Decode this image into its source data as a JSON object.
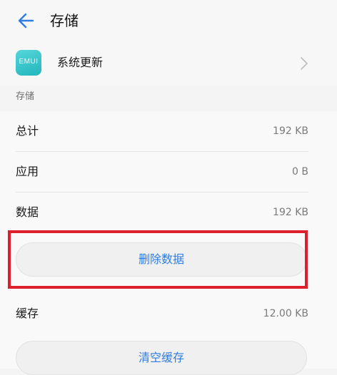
{
  "header": {
    "title": "存储",
    "back_icon": "arrow-left-icon",
    "accent": "#2f7de1"
  },
  "app": {
    "icon_name": "emui-app-icon",
    "icon_text": "EMUI",
    "name": "系统更新",
    "chevron_icon": "chevron-right-icon"
  },
  "storage": {
    "section_label": "存储",
    "rows": [
      {
        "label": "总计",
        "value": "192 KB"
      },
      {
        "label": "应用",
        "value": "0 B"
      },
      {
        "label": "数据",
        "value": "192 KB"
      }
    ],
    "delete_data_label": "删除数据",
    "cache_label": "缓存",
    "cache_value": "12.00 KB",
    "clear_cache_label": "清空缓存"
  },
  "highlight_color": "#dd1f2b"
}
